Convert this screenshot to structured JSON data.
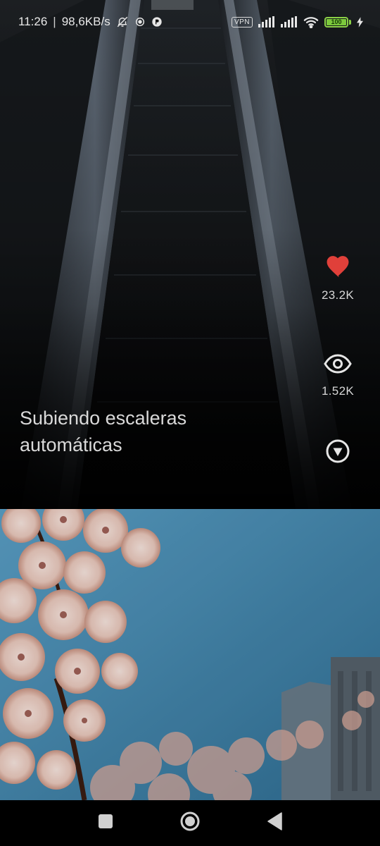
{
  "status_bar": {
    "time": "11:26",
    "separator": "|",
    "net_speed": "98,6KB/s",
    "vpn_label": "VPN",
    "battery_level": "100",
    "icons": [
      "bell-off-icon",
      "sync-icon",
      "app-notification-icon",
      "signal-icon",
      "signal-icon",
      "wifi-icon",
      "battery-icon",
      "charging-bolt-icon"
    ]
  },
  "feed": {
    "cards": [
      {
        "title": "Subiendo escaleras automáticas",
        "likes": "23.2K",
        "views": "1.52K",
        "liked": true,
        "accent_color": "#e0403a",
        "actions": [
          "heart-icon",
          "eye-icon",
          "more-circle-icon"
        ]
      },
      {
        "title": "",
        "image_subject": "cherry blossoms against blue sky"
      }
    ]
  },
  "nav_bar": {
    "buttons": [
      "recents-square-icon",
      "home-circle-icon",
      "back-triangle-icon"
    ]
  }
}
